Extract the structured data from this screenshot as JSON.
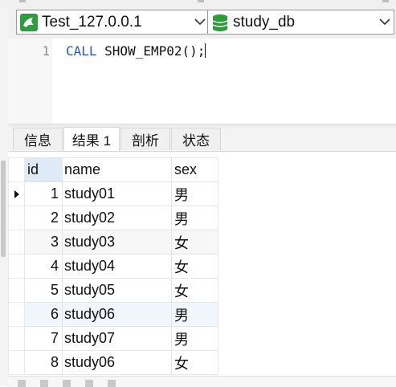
{
  "toolbar": {
    "connection": {
      "label": "Test_127.0.0.1",
      "icon": "connection-icon"
    },
    "database": {
      "label": "study_db",
      "icon": "database-icon"
    }
  },
  "editor": {
    "line_number": "1",
    "keyword": "CALL",
    "statement": " SHOW_EMP02();"
  },
  "tabs": [
    {
      "label": "信息"
    },
    {
      "label": "结果 1"
    },
    {
      "label": "剖析"
    },
    {
      "label": "状态"
    }
  ],
  "grid": {
    "columns": [
      "id",
      "name",
      "sex"
    ],
    "rows": [
      {
        "id": "1",
        "name": "study01",
        "sex": "男"
      },
      {
        "id": "2",
        "name": "study02",
        "sex": "男"
      },
      {
        "id": "3",
        "name": "study03",
        "sex": "女"
      },
      {
        "id": "4",
        "name": "study04",
        "sex": "女"
      },
      {
        "id": "5",
        "name": "study05",
        "sex": "女"
      },
      {
        "id": "6",
        "name": "study06",
        "sex": "男"
      },
      {
        "id": "7",
        "name": "study07",
        "sex": "男"
      },
      {
        "id": "8",
        "name": "study06",
        "sex": "女"
      }
    ]
  },
  "colors": {
    "keyword": "#2357c7",
    "connection_icon_bg": "#2e9c3c",
    "database_icon": "#2e9c3c",
    "sorted_header": "#dfeaf7"
  }
}
